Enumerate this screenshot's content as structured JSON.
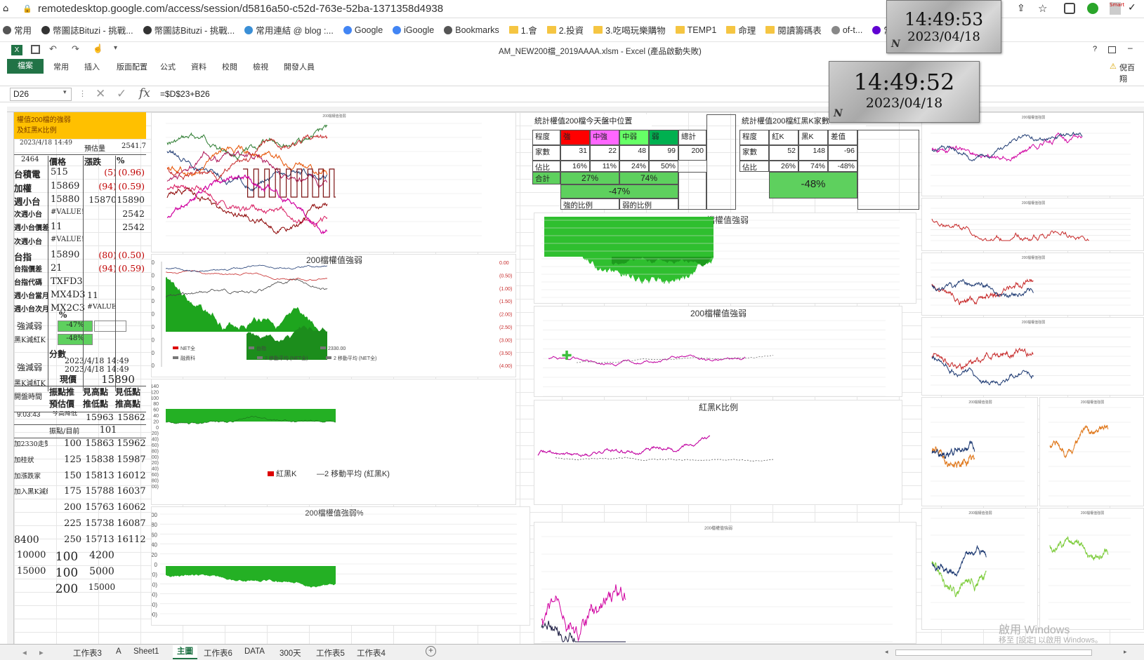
{
  "browser": {
    "url": "remotedesktop.google.com/access/session/d5816a50-c52d-763e-52ba-1371358d4938",
    "bookmarks": [
      "常用",
      "幣圖誌Bituzi - 挑戰...",
      "幣圖誌Bituzi - 挑戰...",
      "常用連結 @ blog :...",
      "Google",
      "iGoogle",
      "Bookmarks",
      "1.會",
      "2.投資",
      "3.吃喝玩樂購物",
      "TEMP1",
      "命理",
      "閱讀籌碼表",
      "of-t...",
      "常用 - 小歐戶的BL...",
      "DJ"
    ]
  },
  "clocks": [
    {
      "time": "14:49:53",
      "date": "2023/04/18",
      "mark": "N"
    },
    {
      "time": "14:49:52",
      "date": "2023/04/18",
      "mark": "N"
    }
  ],
  "excel": {
    "title": "AM_NEW200檔_2019AAAA.xlsm - Excel (產品啟動失敗)",
    "tabs": [
      "檔案",
      "常用",
      "插入",
      "版面配置",
      "公式",
      "資料",
      "校閱",
      "檢視",
      "開發人員"
    ],
    "namebox": "D26",
    "formula": "=$D$23+B26",
    "user": "倪百 翔",
    "help": "?"
  },
  "left": {
    "header": "權值200檔的強弱\n及紅黑K比例",
    "datetime1": "2023/4/18 14:49",
    "est_label": "預估量",
    "est_value": "2541.7",
    "col_n": "2464",
    "col_price": "價格",
    "col_chg": "漲跌",
    "col_pct": "%",
    "rows": [
      {
        "name": "台積電",
        "price": "515",
        "chg": "(5)",
        "pct": "(0.96)"
      },
      {
        "name": "加權",
        "price": "15869",
        "chg": "(94)",
        "pct": "(0.59)"
      },
      {
        "name": "週小台",
        "price": "15880",
        "chg": "15870",
        "pct": "15890"
      },
      {
        "name": "次週小台",
        "price": "#VALUE!",
        "chg": "",
        "pct": "2542"
      },
      {
        "name": "週小台價差",
        "price": "11",
        "chg": "",
        "pct": "2542"
      },
      {
        "name": "次週小台",
        "price": "#VALUE!",
        "chg": "",
        "pct": ""
      },
      {
        "name": "台指",
        "price": "15890",
        "chg": "(80)",
        "pct": "(0.50)"
      },
      {
        "name": "台指價差",
        "price": "21",
        "chg": "(94)",
        "pct": "(0.59)"
      },
      {
        "name": "台指代碼",
        "price": "TXFD3",
        "chg": "",
        "pct": ""
      },
      {
        "name": "週小台當月",
        "price": "MX4D3",
        "chg": "11",
        "pct": ""
      },
      {
        "name": "週小台次月",
        "price": "MX2C3",
        "chg": "#VALUE!",
        "pct": ""
      }
    ],
    "pct_label": "%",
    "strength_label": "強減弱",
    "strength_value": "-47%",
    "rk_label": "黑K減紅K",
    "rk_value": "-48%",
    "score_label": "分數",
    "strength_label2": "強減弱",
    "datetime2": "2023/4/18 14:49",
    "datetime3": "2023/4/18 14:49",
    "rk_label2": "黑K減紅K",
    "now_label": "現價",
    "now_value": "15890",
    "open_label": "開盤時間",
    "open_time": "9:03:43",
    "h1": "振點推預估價",
    "h2": "見高點推低點",
    "h3": "見低點推高點",
    "today": "今高降低",
    "v1": "15963",
    "v2": "15862",
    "pts_label": "振點/目前",
    "pts_value": "101",
    "grid": [
      [
        "加2330走勢",
        "100",
        "15863",
        "15962"
      ],
      [
        "加桂狀",
        "125",
        "15838",
        "15987"
      ],
      [
        "加漲跌家",
        "150",
        "15813",
        "16012"
      ],
      [
        "加入黑K減紅K",
        "175",
        "15788",
        "16037"
      ],
      [
        "",
        "200",
        "15763",
        "16062"
      ],
      [
        "",
        "225",
        "15738",
        "16087"
      ],
      [
        "8400",
        "250",
        "15713",
        "16112"
      ]
    ],
    "bottom": [
      [
        "10000",
        "100",
        "4200"
      ],
      [
        "15000",
        "100",
        "5000"
      ],
      [
        "",
        "200",
        "15000"
      ]
    ]
  },
  "stat1": {
    "title": "統計權值200檔今天盤中位置",
    "hdr": [
      "程度",
      "強",
      "中強",
      "中弱",
      "弱",
      "總計"
    ],
    "count_label": "家數",
    "counts": [
      "31",
      "22",
      "48",
      "99",
      "200"
    ],
    "ratio_label": "佔比",
    "ratios": [
      "16%",
      "11%",
      "24%",
      "50%"
    ],
    "sum_label": "合計",
    "sum_a": "27%",
    "sum_b": "74%",
    "net": "-47%",
    "strong_label": "強的比例",
    "weak_label": "弱的比例"
  },
  "stat2": {
    "title": "統計權值200檔紅黑K家數",
    "hdr": [
      "程度",
      "紅K",
      "黑K",
      "差值"
    ],
    "count_label": "家數",
    "counts": [
      "52",
      "148",
      "-96"
    ],
    "ratio_label": "佔比",
    "ratios": [
      "26%",
      "74%",
      "-48%"
    ],
    "net": "-48%"
  },
  "charts": {
    "c1_title": "200檔權值強弱",
    "c2_title": "200檔權值強弱",
    "c2_legend": [
      "NET全",
      "台指",
      "2330.00",
      "融資科",
      "2 移動平均 (NET全)",
      "2 移動平均 (NET全)"
    ],
    "c2_left_ticks": [
      "0",
      "-10",
      "-20",
      "-30",
      "-40",
      "-50",
      "-60",
      "-70",
      "-80"
    ],
    "c2_right_ticks": [
      "0.00",
      "(0.50)",
      "(1.00)",
      "(1.50)",
      "(2.00)",
      "(2.50)",
      "(3.00)",
      "(3.50)",
      "(4.00)"
    ],
    "c3_ticks": [
      "140",
      "120",
      "100",
      "80",
      "60",
      "40",
      "20",
      "0",
      "(20)",
      "(40)",
      "(60)",
      "(80)",
      "(100)",
      "(120)",
      "(140)",
      "(160)",
      "(180)",
      "(200)"
    ],
    "c3_legend": [
      "紅黑K",
      "2 移動平均 (紅黑K)"
    ],
    "c4_title": "200檔權值強弱%",
    "c4_ticks": [
      "100",
      "80",
      "60",
      "40",
      "20",
      "0",
      "(20)",
      "(40)",
      "(60)",
      "(80)",
      "(100)"
    ],
    "c5_title": "200檔權值強弱",
    "c6_title": "200檔權值強弱",
    "c6_ticks": [
      "100",
      "75",
      "50",
      "25",
      "0",
      "-25",
      "-50",
      "-75",
      "-100"
    ],
    "c7_title": "紅黑K比例",
    "c7_ticks": [
      "0",
      "-25",
      "-50",
      "-75",
      "-100",
      "-125",
      "-150"
    ],
    "small_title": "200檔權值強弱"
  },
  "sheets": [
    "工作表3",
    "A",
    "Sheet1",
    "主圖",
    "工作表6",
    "DATA",
    "300天",
    "工作表5",
    "工作表4"
  ],
  "active_sheet": "主圖",
  "watermark": {
    "line1": "啟用 Windows",
    "line2": "移至 [設定] 以啟用 Windows。"
  }
}
